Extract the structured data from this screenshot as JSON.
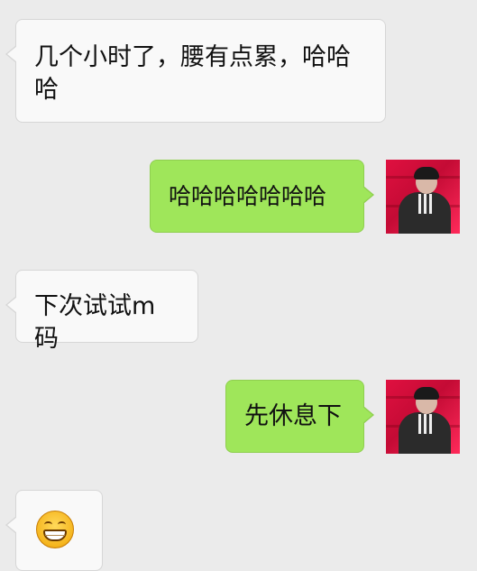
{
  "messages": [
    {
      "side": "incoming",
      "text": "几个小时了，腰有点累，哈哈哈"
    },
    {
      "side": "outgoing",
      "text": "哈哈哈哈哈哈哈"
    },
    {
      "side": "incoming",
      "text": "下次试试m码"
    },
    {
      "side": "outgoing",
      "text": "先休息下"
    },
    {
      "side": "incoming",
      "emoji": "grinning-face-emoji"
    }
  ],
  "colors": {
    "background": "#ebebeb",
    "incoming_bubble": "#f9f9f9",
    "outgoing_bubble": "#9fe65a"
  }
}
